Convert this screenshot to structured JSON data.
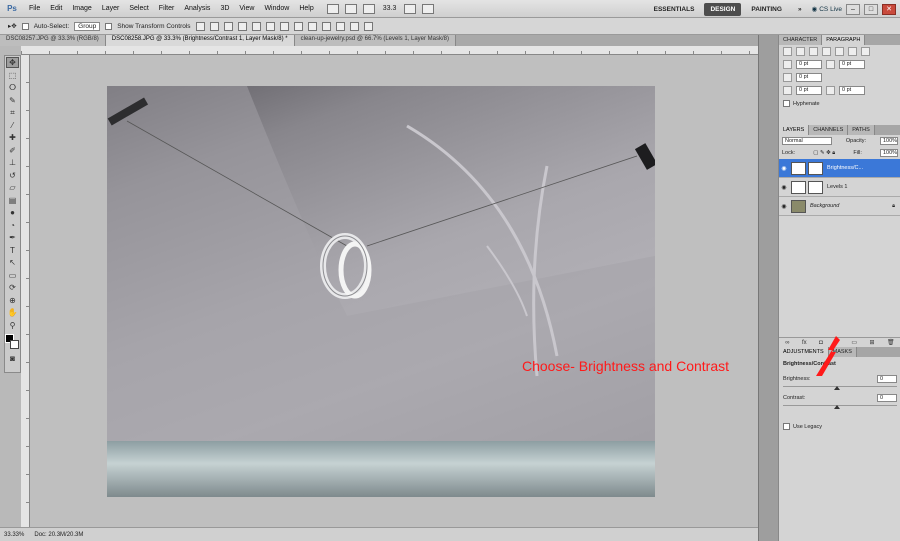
{
  "menubar": {
    "logo": "Ps",
    "items": [
      "File",
      "Edit",
      "Image",
      "Layer",
      "Select",
      "Filter",
      "Analysis",
      "3D",
      "View",
      "Window",
      "Help"
    ],
    "zoom": "33.3",
    "workspaces": [
      "ESSENTIALS",
      "DESIGN",
      "PAINTING"
    ],
    "cs_live": "CS Live",
    "window_buttons": [
      "–",
      "□",
      "✕"
    ]
  },
  "options": {
    "auto_select_label": "Auto-Select:",
    "auto_select_value": "Group",
    "show_transform_label": "Show Transform Controls"
  },
  "tabs": [
    {
      "label": "DSC08257.JPG @ 33.3% (RGB/8)"
    },
    {
      "label": "DSC08258.JPG @ 33.3% (Brightness/Contrast 1, Layer Mask/8) *"
    },
    {
      "label": "clean-up-jewelry.psd @ 66.7% (Levels 1, Layer Mask/8)"
    }
  ],
  "status": {
    "zoom": "33.33%",
    "doc": "Doc: 20.3M/20.3M"
  },
  "paragraph": {
    "tabs": [
      "CHARACTER",
      "PARAGRAPH"
    ],
    "fields": [
      "0 pt",
      "0 pt",
      "0 pt",
      "0 pt",
      "0 pt"
    ],
    "hyphenate": "Hyphenate"
  },
  "layers": {
    "tabs": [
      "LAYERS",
      "CHANNELS",
      "PATHS"
    ],
    "blend_mode": "Normal",
    "opacity_label": "Opacity:",
    "opacity": "100%",
    "lock_label": "Lock:",
    "fill_label": "Fill:",
    "fill": "100%",
    "items": [
      {
        "name": "Brightness/C...",
        "selected": true
      },
      {
        "name": "Levels 1",
        "selected": false
      },
      {
        "name": "Background",
        "selected": false
      }
    ],
    "footer_icons": [
      "fx"
    ]
  },
  "adjustments": {
    "tabs": [
      "ADJUSTMENTS",
      "MASKS"
    ],
    "title": "Brightness/Contrast",
    "brightness_label": "Brightness:",
    "brightness": "0",
    "contrast_label": "Contrast:",
    "contrast": "0",
    "use_legacy": "Use Legacy"
  },
  "annotation": "Choose- Brightness and Contrast",
  "colors": {
    "accent": "#3b78d8",
    "annotation": "#ff1a1a"
  }
}
